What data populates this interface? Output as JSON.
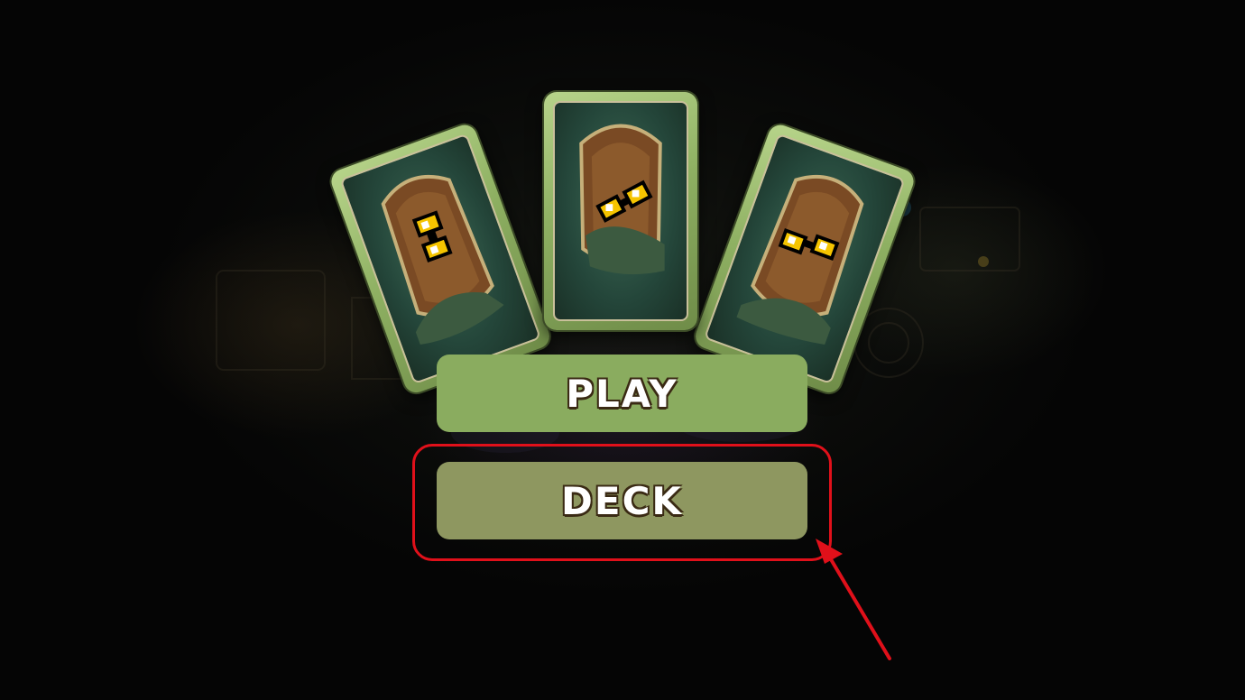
{
  "menu": {
    "play_label": "PLAY",
    "deck_label": "DECK"
  },
  "cards": [
    {
      "name": "card-left",
      "icon": "glasses-icon"
    },
    {
      "name": "card-center",
      "icon": "glasses-icon"
    },
    {
      "name": "card-right",
      "icon": "glasses-icon"
    }
  ],
  "annotation": {
    "highlight_target": "deck-button",
    "highlight_color": "#e0101a"
  },
  "colors": {
    "play_button": "#8aac5f",
    "deck_button": "#8e9760",
    "card_frame": "#8eb062",
    "background": "#050505"
  }
}
